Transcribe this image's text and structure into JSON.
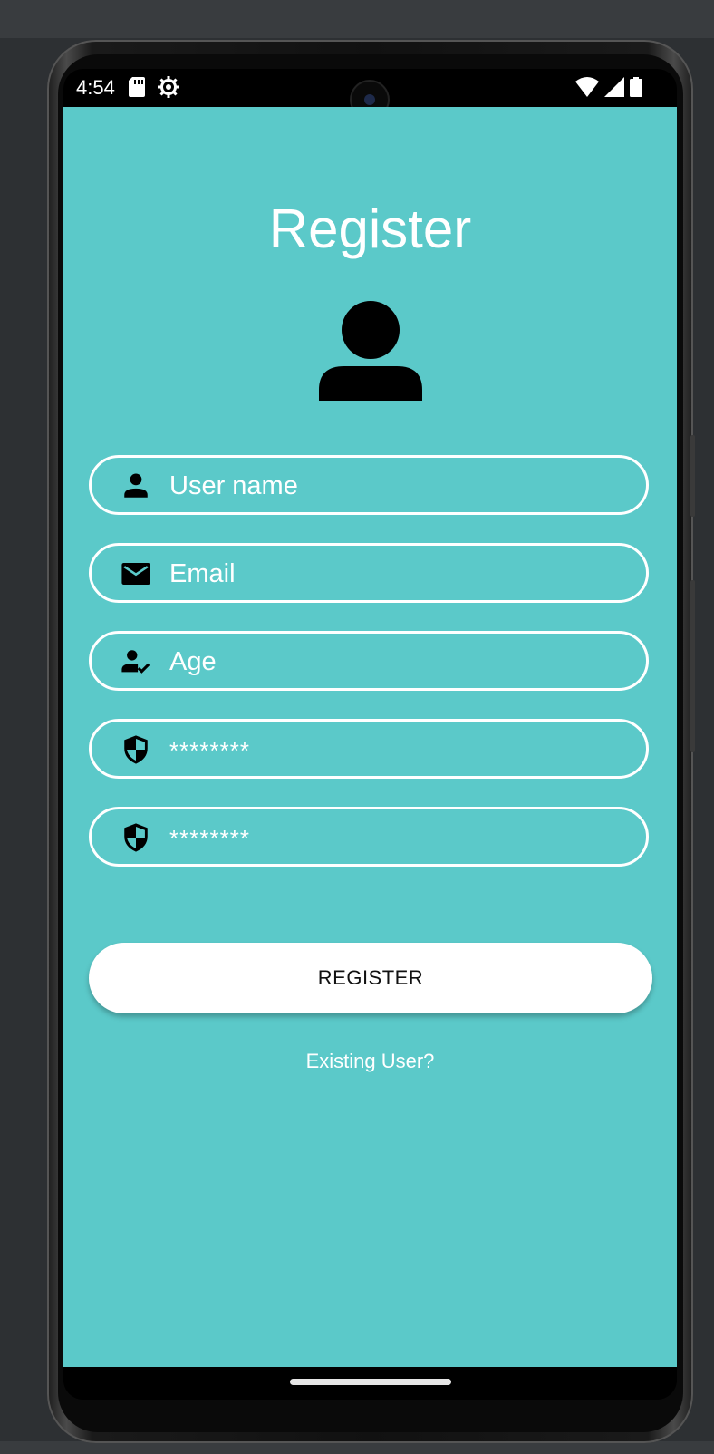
{
  "status_bar": {
    "time": "4:54",
    "icons": [
      "sd-card-icon",
      "gear-icon",
      "wifi-icon",
      "signal-icon",
      "battery-icon"
    ]
  },
  "page": {
    "title": "Register",
    "avatar_icon": "person-icon",
    "background_color": "#5bc9c9"
  },
  "form": {
    "username": {
      "icon": "person-icon",
      "placeholder": "User name"
    },
    "email": {
      "icon": "mail-icon",
      "placeholder": "Email"
    },
    "age": {
      "icon": "person-check-icon",
      "placeholder": "Age"
    },
    "password": {
      "icon": "shield-icon",
      "placeholder": "********"
    },
    "confirm_password": {
      "icon": "shield-icon",
      "placeholder": "********"
    }
  },
  "actions": {
    "register_label": "REGISTER",
    "existing_user_label": "Existing User?"
  }
}
